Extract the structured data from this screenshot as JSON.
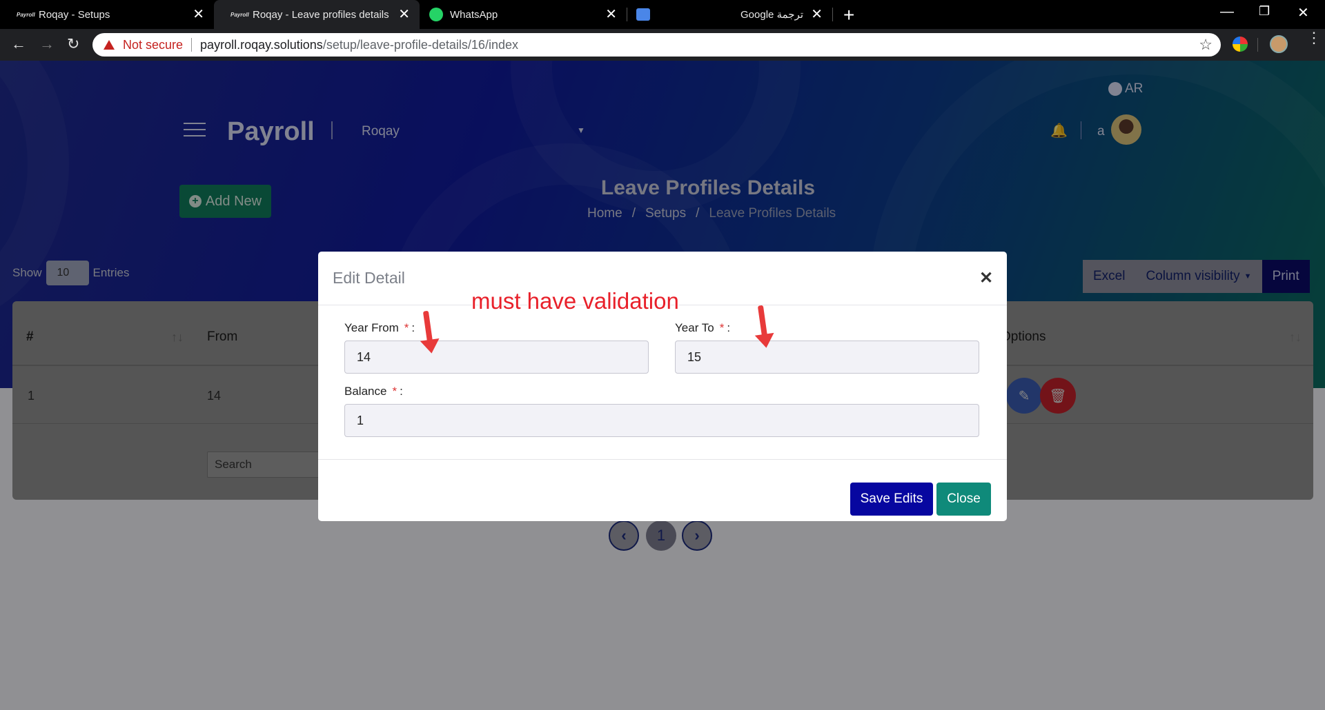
{
  "browser": {
    "tabs": [
      {
        "title": "Roqay - Setups",
        "favicon": "Payroll"
      },
      {
        "title": "Roqay - Leave profiles details",
        "favicon": "Payroll"
      },
      {
        "title": "WhatsApp",
        "favicon": "whatsapp-icon"
      },
      {
        "title": "Google ترجمة",
        "favicon": "google-translate-icon"
      }
    ],
    "security_label": "Not secure",
    "url_host": "payroll.roqay.solutions",
    "url_path": "/setup/leave-profile-details/16/index"
  },
  "header": {
    "brand": "Payroll",
    "company": "Roqay",
    "language": "AR",
    "user_initial": "a"
  },
  "page": {
    "add_new_label": "Add New",
    "title": "Leave Profiles Details",
    "breadcrumbs": [
      "Home",
      "/",
      "Setups",
      "/",
      "Leave Profiles Details"
    ],
    "show_label": "Show",
    "entries_count": "10",
    "entries_label": "Entries",
    "export_buttons": {
      "excel": "Excel",
      "column_visibility": "Column visibility",
      "print": "Print"
    }
  },
  "table": {
    "columns": [
      "#",
      "From",
      "Options"
    ],
    "rows": [
      {
        "index": "1",
        "from": "14"
      }
    ],
    "search_placeholder": "Search"
  },
  "pagination": {
    "current": "1"
  },
  "modal": {
    "title": "Edit Detail",
    "year_from_label": "Year From",
    "year_from_value": "14",
    "year_to_label": "Year To",
    "year_to_value": "15",
    "balance_label": "Balance",
    "balance_value": "1",
    "required_mark": "*",
    "colon": ":",
    "save_label": "Save Edits",
    "close_label": "Close"
  },
  "annotation": {
    "text": "must have validation",
    "color": "#e8202a"
  },
  "colors": {
    "save_button": "#0707a0",
    "close_button": "#0f8a7a",
    "delete_button": "#c0202a",
    "edit_button": "#3a5ab0"
  }
}
